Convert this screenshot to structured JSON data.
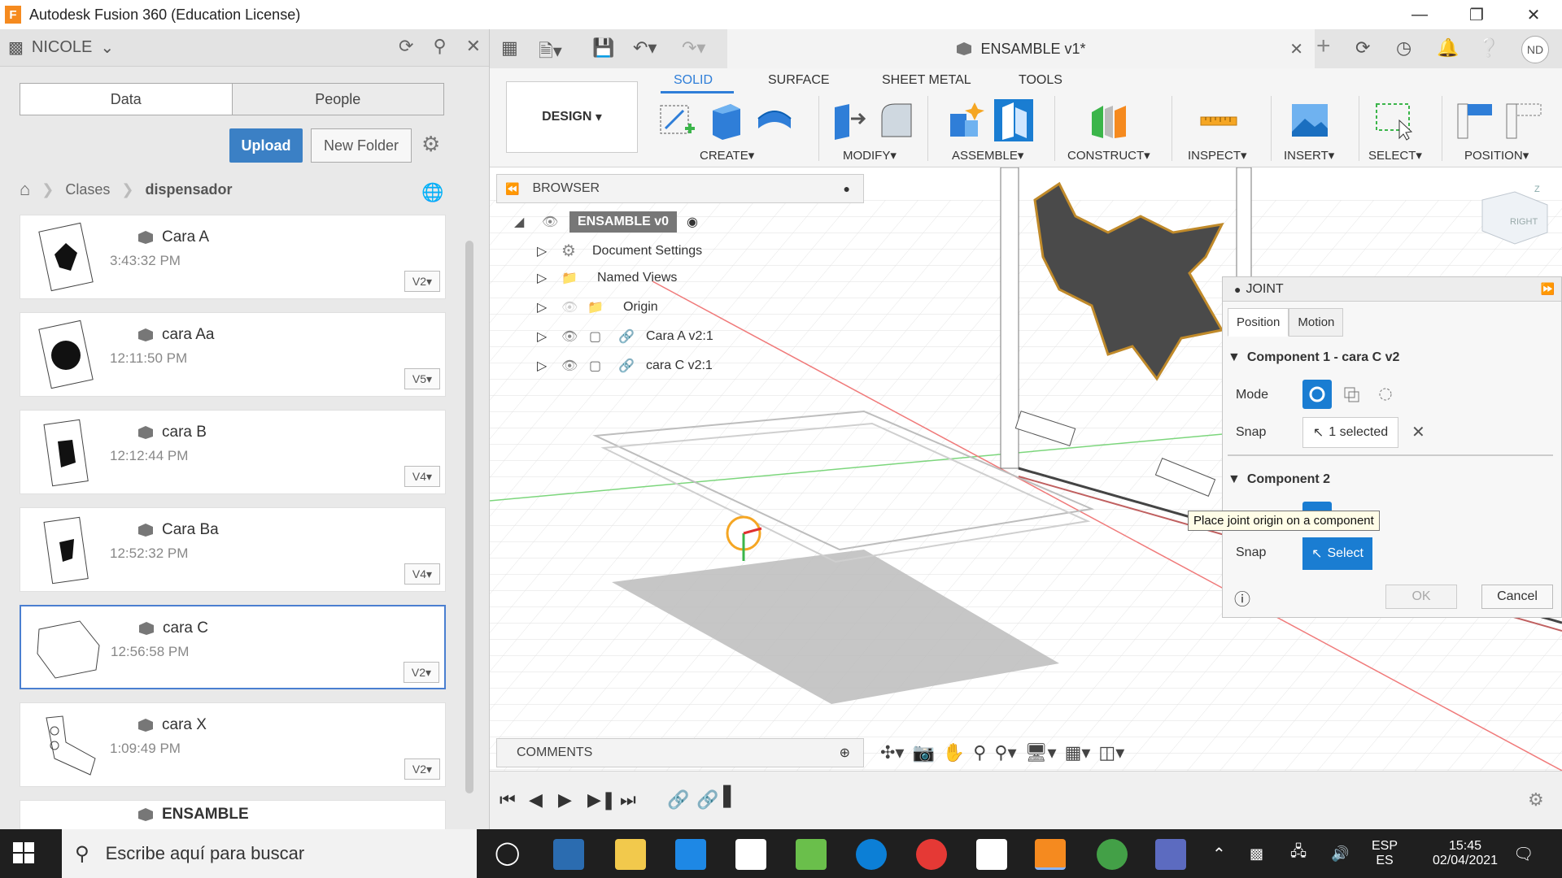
{
  "window": {
    "title": "Autodesk Fusion 360 (Education License)",
    "logo_letter": "F"
  },
  "data_panel": {
    "user": "NICOLE",
    "tabs": [
      "Data",
      "People"
    ],
    "upload_label": "Upload",
    "new_folder_label": "New Folder",
    "breadcrumb": [
      "Clases",
      "dispensador"
    ],
    "files": [
      {
        "name": "Cara A",
        "time": "3:43:32 PM",
        "version": "V2"
      },
      {
        "name": "cara Aa",
        "time": "12:11:50 PM",
        "version": "V5"
      },
      {
        "name": "cara B",
        "time": "12:12:44 PM",
        "version": "V4"
      },
      {
        "name": "Cara Ba",
        "time": "12:52:32 PM",
        "version": "V4"
      },
      {
        "name": "cara C",
        "time": "12:56:58 PM",
        "version": "V2"
      },
      {
        "name": "cara X",
        "time": "1:09:49 PM",
        "version": "V2"
      },
      {
        "name": "ENSAMBLE",
        "time": "",
        "version": ""
      }
    ]
  },
  "document": {
    "tab_title": "ENSAMBLE v1*",
    "avatar": "ND"
  },
  "ribbon": {
    "workspace": "DESIGN",
    "tabs": [
      "SOLID",
      "SURFACE",
      "SHEET METAL",
      "TOOLS"
    ],
    "groups": [
      "CREATE",
      "MODIFY",
      "ASSEMBLE",
      "CONSTRUCT",
      "INSPECT",
      "INSERT",
      "SELECT",
      "POSITION"
    ]
  },
  "browser": {
    "title": "BROWSER",
    "root": "ENSAMBLE v0",
    "items": [
      "Document Settings",
      "Named Views",
      "Origin",
      "Cara A v2:1",
      "cara C v2:1"
    ]
  },
  "comments": {
    "title": "COMMENTS"
  },
  "viewcube": {
    "face": "RIGHT",
    "axis": "Z"
  },
  "joint": {
    "title": "JOINT",
    "tabs": [
      "Position",
      "Motion"
    ],
    "component1": "Component 1 - cara C v2",
    "component2": "Component 2",
    "mode_label": "Mode",
    "snap_label": "Snap",
    "snap1_value": "1 selected",
    "snap2_value": "Select",
    "tooltip": "Place joint origin on a component",
    "ok": "OK",
    "cancel": "Cancel"
  },
  "taskbar": {
    "search_placeholder": "Escribe aquí para buscar",
    "lang_top": "ESP",
    "lang_bottom": "ES",
    "time": "15:45",
    "date": "02/04/2021"
  },
  "colors": {
    "accent_blue": "#2f7ed8",
    "upload_blue": "#3b80c5",
    "select_blue": "#1a7dd2",
    "fusion_orange": "#f58a1f"
  }
}
